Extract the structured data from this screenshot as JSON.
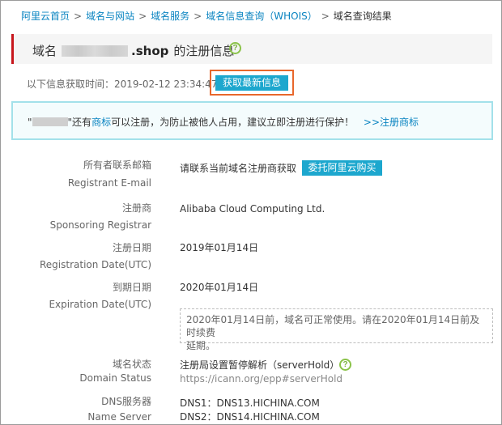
{
  "breadcrumb": {
    "items": [
      "阿里云首页",
      "域名与网站",
      "域名服务",
      "域名信息查询（WHOIS）"
    ],
    "current": "域名查询结果",
    "separator": ">"
  },
  "title": {
    "prefix": "域名",
    "domain": ".shop",
    "suffix": "的注册信息",
    "help_icon": "?"
  },
  "fetch": {
    "label": "以下信息获取时间：2019-02-12 23:34:47",
    "button": "获取最新信息"
  },
  "notice": {
    "quote_open": "\"",
    "text_a": "\"还有",
    "link1": "商标",
    "text_b": "可以注册，为防止被他人占用，建议立即注册进行保护！",
    "link2": ">>注册商标"
  },
  "rows": {
    "email": {
      "label_cn": "所有者联系邮箱",
      "label_en": "Registrant E-mail",
      "value": "请联系当前域名注册商获取",
      "button": "委托阿里云购买"
    },
    "registrar": {
      "label_cn": "注册商",
      "label_en": "Sponsoring Registrar",
      "value": "Alibaba Cloud Computing Ltd."
    },
    "reg_date": {
      "label_cn": "注册日期",
      "label_en": "Registration Date(UTC)",
      "value": "2019年01月14日"
    },
    "exp_date": {
      "label_cn": "到期日期",
      "label_en": "Expiration Date(UTC)",
      "value": "2020年01月14日",
      "note_line1": "2020年01月14日前，域名可正常使用。请在2020年01月14日前及时续费",
      "note_line2": "延期。"
    },
    "status": {
      "label_cn": "域名状态",
      "label_en": "Domain Status",
      "value": "注册局设置暂停解析（serverHold）",
      "link": "https://icann.org/epp#serverHold",
      "help_icon": "?"
    },
    "dns": {
      "label_cn": "DNS服务器",
      "label_en": "Name Server",
      "dns1": "DNS1：DNS13.HICHINA.COM",
      "dns2": "DNS2：DNS14.HICHINA.COM"
    }
  },
  "colors": {
    "accent": "#1da7ce",
    "link": "#0a84c1",
    "brand_red": "#c7161c",
    "highlight": "#e8672b"
  }
}
